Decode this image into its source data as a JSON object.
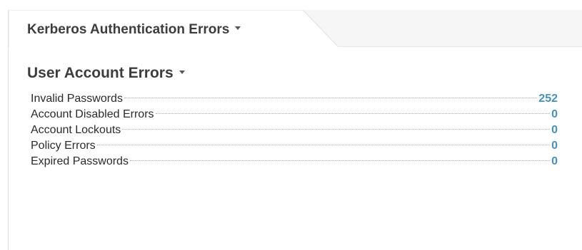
{
  "tab": {
    "title": "Kerberos Authentication Errors"
  },
  "section": {
    "title": "User Account Errors",
    "rows": [
      {
        "label": "Invalid Passwords",
        "value": "252"
      },
      {
        "label": "Account Disabled Errors",
        "value": "0"
      },
      {
        "label": "Account Lockouts",
        "value": "0"
      },
      {
        "label": "Policy Errors",
        "value": "0"
      },
      {
        "label": "Expired Passwords",
        "value": "0"
      }
    ]
  },
  "icons": {
    "tab_dropdown": "chevron-down-icon",
    "section_dropdown": "chevron-down-icon"
  },
  "colors": {
    "value_link": "#4a90b8",
    "title_text": "#3d3d3d",
    "tab_strip": "#f6f6f6"
  }
}
